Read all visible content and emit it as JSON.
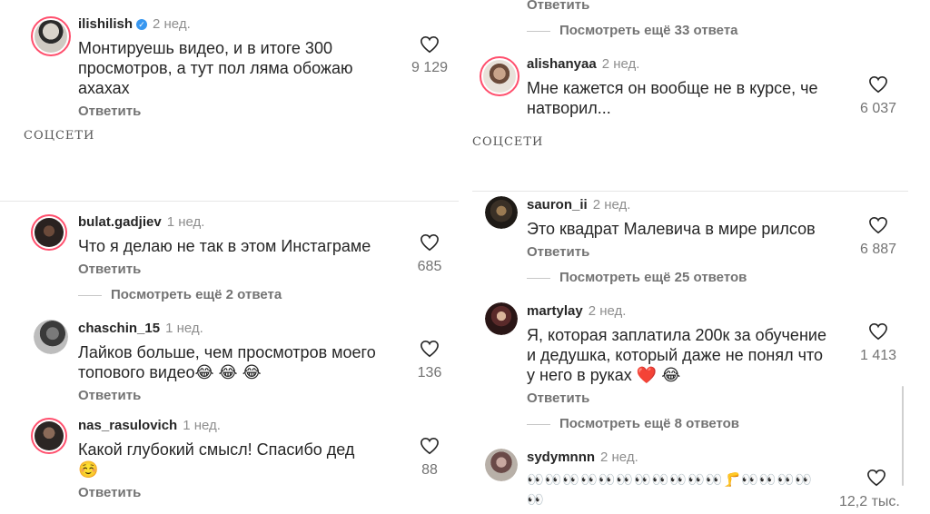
{
  "left": {
    "top": {
      "username": "ilishilish",
      "time": "2 нед.",
      "text_lines": [
        "Монтируешь видео,  и в итоге 300",
        "просмотров, а тут пол ляма обожаю",
        "ахахах"
      ],
      "likes": "9 129",
      "reply": "Ответить"
    },
    "source": "СОЦСЕТИ",
    "comments": [
      {
        "username": "bulat.gadjiev",
        "time": "1 нед.",
        "text_lines": [
          "Что я делаю не так в этом Инстаграме"
        ],
        "likes": "685",
        "reply": "Ответить",
        "more": "Посмотреть ещё 2 ответа"
      },
      {
        "username": "chaschin_15",
        "time": "1 нед.",
        "text_lines": [
          "Лайков больше, чем просмотров моего",
          "топового видео😂 😂 😂"
        ],
        "likes": "136",
        "reply": "Ответить"
      },
      {
        "username": "nas_rasulovich",
        "time": "1 нед.",
        "text_lines": [
          "Какой глубокий смысл! Спасибо дед",
          "☺️"
        ],
        "likes": "88",
        "reply": "Ответить"
      }
    ]
  },
  "right": {
    "top_reply": "Ответить",
    "top_more": "Посмотреть ещё 33 ответа",
    "top": {
      "username": "alishanyaa",
      "time": "2 нед.",
      "text_lines": [
        "Мне кажется он вообще не в курсе, че",
        "натворил..."
      ],
      "likes": "6 037"
    },
    "source": "СОЦСЕТИ",
    "comments": [
      {
        "username": "sauron_ii",
        "time": "2 нед.",
        "text_lines": [
          "Это квадрат Малевича в мире рилсов"
        ],
        "likes": "6 887",
        "reply": "Ответить",
        "more": "Посмотреть ещё 25 ответов"
      },
      {
        "username": "martylay",
        "time": "2 нед.",
        "text_lines": [
          "Я, которая заплатила 200к за обучение",
          "и дедушка, который даже не понял что",
          "у него в руках ❤️ 😂"
        ],
        "likes": "1 413",
        "reply": "Ответить",
        "more": "Посмотреть ещё 8 ответов"
      },
      {
        "username": "sydymnnn",
        "time": "2 нед.",
        "text_lines": [
          "👀👀👀👀👀👀👀👀👀👀👀🦵👀👀👀👀",
          "👀"
        ],
        "likes": "12,2 тыс."
      }
    ]
  }
}
